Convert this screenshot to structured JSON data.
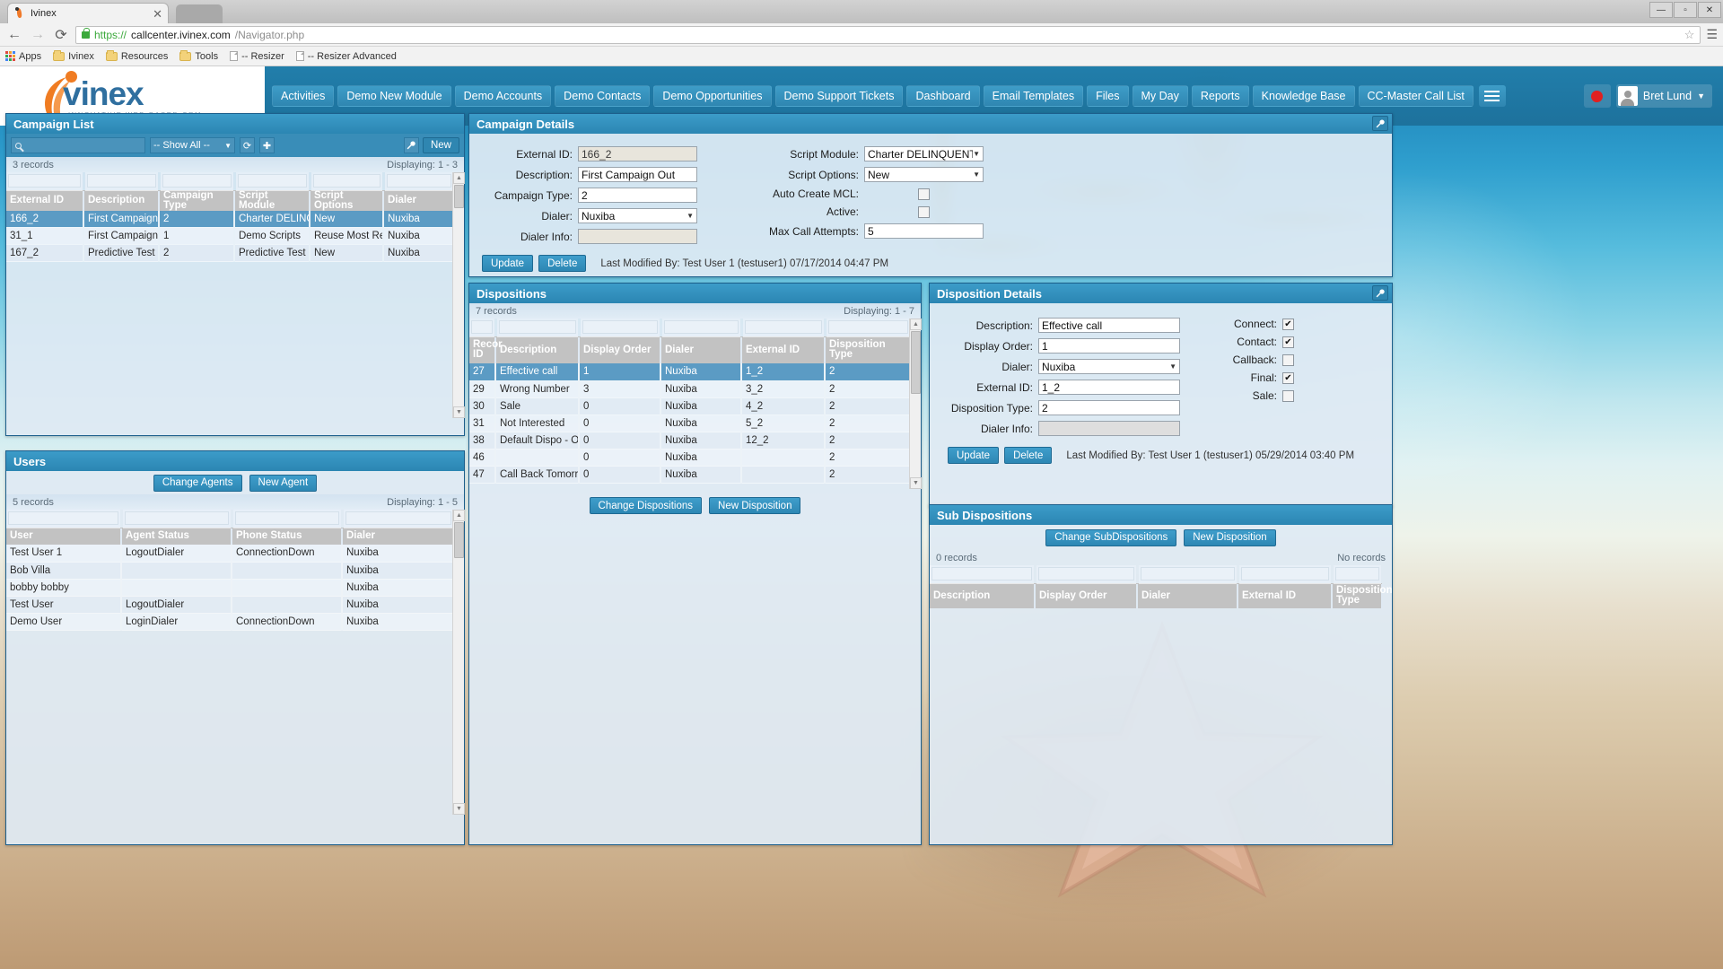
{
  "browser": {
    "tab_title": "Ivinex",
    "tab_close": "✕",
    "back_icon": "←",
    "forward_icon": "→",
    "reload_icon": "⟳",
    "url_scheme": "https://",
    "url_host": "callcenter.ivinex.com",
    "url_path": "/Navigator.php",
    "star_icon": "☆",
    "menu_icon": "☰",
    "window_minimize": "—",
    "window_maximize": "▫",
    "window_close": "✕",
    "bookmarks": [
      {
        "label": "Apps",
        "icon": "apps-grid-icon"
      },
      {
        "label": "Ivinex",
        "icon": "folder-icon"
      },
      {
        "label": "Resources",
        "icon": "folder-icon"
      },
      {
        "label": "Tools",
        "icon": "folder-icon"
      },
      {
        "label": "-- Resizer",
        "icon": "page-icon"
      },
      {
        "label": "-- Resizer Advanced",
        "icon": "page-icon"
      }
    ]
  },
  "app": {
    "logo_word": "vinex",
    "logo_tagline": "INNOVATIVE WEB-BASED CRM",
    "nav_items": [
      "Activities",
      "Demo New Module",
      "Demo Accounts",
      "Demo Contacts",
      "Demo Opportunities",
      "Demo Support Tickets",
      "Dashboard",
      "Email Templates",
      "Files",
      "My Day",
      "Reports",
      "Knowledge Base",
      "CC-Master Call List"
    ],
    "hamburger_icon": "hamburger-icon",
    "record_icon": "record-dot-icon",
    "user_name": "Bret Lund",
    "user_caret": "▼"
  },
  "campaign_list": {
    "title": "Campaign List",
    "search_placeholder": "",
    "search_value": "",
    "filter_selected": "-- Show All --",
    "refresh_icon": "⟳",
    "add_icon": "✚",
    "wrench_icon": "🔧",
    "new_label": "New",
    "records": "3 records",
    "displaying": "Displaying: 1 - 3",
    "columns": [
      "External ID",
      "Description",
      "Campaign Type",
      "Script Module",
      "Script Options",
      "Dialer"
    ],
    "rows": [
      {
        "selected": true,
        "cells": [
          "166_2",
          "First Campaign Ou",
          "2",
          "Charter DELINQU",
          "New",
          "Nuxiba"
        ]
      },
      {
        "selected": false,
        "cells": [
          "31_1",
          "First Campaign In",
          "1",
          "Demo Scripts",
          "Reuse Most Rece",
          "Nuxiba"
        ]
      },
      {
        "selected": false,
        "cells": [
          "167_2",
          "Predictive Test",
          "2",
          "Predictive Test Sc",
          "New",
          "Nuxiba"
        ]
      }
    ]
  },
  "campaign_details": {
    "title": "Campaign Details",
    "wrench_icon": "🔧",
    "fields_left": [
      {
        "label": "External ID:",
        "value": "166_2",
        "type": "readonly"
      },
      {
        "label": "Description:",
        "value": "First Campaign Out",
        "type": "text"
      },
      {
        "label": "Campaign Type:",
        "value": "2",
        "type": "text"
      },
      {
        "label": "Dialer:",
        "value": "Nuxiba",
        "type": "select"
      },
      {
        "label": "Dialer Info:",
        "value": "",
        "type": "readonly"
      }
    ],
    "fields_right": [
      {
        "label": "Script Module:",
        "value": "Charter DELINQUENT Scri",
        "type": "select"
      },
      {
        "label": "Script Options:",
        "value": "New",
        "type": "select"
      },
      {
        "label": "Auto Create MCL:",
        "value": "",
        "type": "checkbox",
        "checked": false
      },
      {
        "label": "Active:",
        "value": "",
        "type": "checkbox",
        "checked": false
      },
      {
        "label": "Max Call Attempts:",
        "value": "5",
        "type": "text"
      }
    ],
    "update_label": "Update",
    "delete_label": "Delete",
    "last_modified": "Last Modified By: Test User 1 (testuser1) 07/17/2014 04:47 PM"
  },
  "users": {
    "title": "Users",
    "change_agents_label": "Change Agents",
    "new_agent_label": "New Agent",
    "records": "5 records",
    "displaying": "Displaying: 1 - 5",
    "columns": [
      "User",
      "Agent Status",
      "Phone Status",
      "Dialer"
    ],
    "rows": [
      {
        "cells": [
          "Test User 1",
          "LogoutDialer",
          "ConnectionDown",
          "Nuxiba"
        ],
        "status_red": true
      },
      {
        "cells": [
          "Bob Villa",
          "",
          "",
          "Nuxiba"
        ],
        "status_red": false
      },
      {
        "cells": [
          "bobby bobby",
          "",
          "",
          "Nuxiba"
        ],
        "status_red": false
      },
      {
        "cells": [
          "Test User",
          "LogoutDialer",
          "",
          "Nuxiba"
        ],
        "status_red": false
      },
      {
        "cells": [
          "Demo User",
          "LoginDialer",
          "ConnectionDown",
          "Nuxiba"
        ],
        "status_red": true
      }
    ]
  },
  "dispositions": {
    "title": "Dispositions",
    "records": "7 records",
    "displaying": "Displaying: 1 - 7",
    "columns": [
      "Recor ID",
      "Description",
      "Display Order",
      "Dialer",
      "External ID",
      "Disposition Type"
    ],
    "rows": [
      {
        "selected": true,
        "cells": [
          "27",
          "Effective call",
          "1",
          "Nuxiba",
          "1_2",
          "2"
        ]
      },
      {
        "selected": false,
        "cells": [
          "29",
          "Wrong Number",
          "3",
          "Nuxiba",
          "3_2",
          "2"
        ]
      },
      {
        "selected": false,
        "cells": [
          "30",
          "Sale",
          "0",
          "Nuxiba",
          "4_2",
          "2"
        ]
      },
      {
        "selected": false,
        "cells": [
          "31",
          "Not Interested",
          "0",
          "Nuxiba",
          "5_2",
          "2"
        ]
      },
      {
        "selected": false,
        "cells": [
          "38",
          "Default Dispo - Out",
          "0",
          "Nuxiba",
          "12_2",
          "2"
        ]
      },
      {
        "selected": false,
        "cells": [
          "46",
          "",
          "0",
          "Nuxiba",
          "",
          "2"
        ]
      },
      {
        "selected": false,
        "cells": [
          "47",
          "Call Back Tomorrow",
          "0",
          "Nuxiba",
          "",
          "2"
        ]
      }
    ],
    "change_dispositions_label": "Change Dispositions",
    "new_disposition_label": "New Disposition"
  },
  "disposition_details": {
    "title": "Disposition Details",
    "wrench_icon": "🔧",
    "fields_left": [
      {
        "label": "Description:",
        "value": "Effective call",
        "type": "text"
      },
      {
        "label": "Display Order:",
        "value": "1",
        "type": "text"
      },
      {
        "label": "Dialer:",
        "value": "Nuxiba",
        "type": "select"
      },
      {
        "label": "External ID:",
        "value": "1_2",
        "type": "text"
      },
      {
        "label": "Disposition Type:",
        "value": "2",
        "type": "text"
      },
      {
        "label": "Dialer Info:",
        "value": "",
        "type": "readonly"
      }
    ],
    "checkboxes": [
      {
        "label": "Connect:",
        "checked": true
      },
      {
        "label": "Contact:",
        "checked": true
      },
      {
        "label": "Callback:",
        "checked": false
      },
      {
        "label": "Final:",
        "checked": true
      },
      {
        "label": "Sale:",
        "checked": false
      }
    ],
    "update_label": "Update",
    "delete_label": "Delete",
    "last_modified": "Last Modified By: Test User 1 (testuser1) 05/29/2014 03:40 PM"
  },
  "sub_dispositions": {
    "title": "Sub Dispositions",
    "change_label": "Change SubDispositions",
    "new_label": "New Disposition",
    "records": "0 records",
    "no_records": "No records",
    "columns": [
      "Description",
      "Display Order",
      "Dialer",
      "External ID",
      "Disposition Type"
    ]
  }
}
